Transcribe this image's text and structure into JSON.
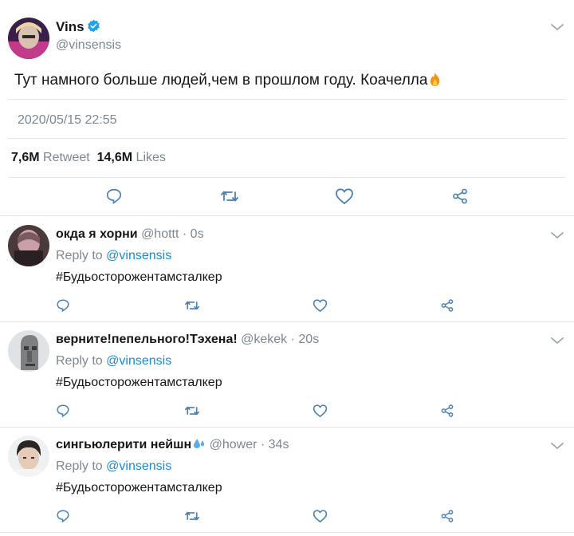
{
  "tweet": {
    "author_name": "Vins",
    "author_handle": "@vinsensis",
    "text": "Тут намного больше людей,чем в прошлом году. Коачелла",
    "text_emoji": "fire-emoji",
    "timestamp": "2020/05/15 22:55",
    "retweets_count": "7,6M",
    "retweets_label": "Retweet",
    "likes_count": "14,6M",
    "likes_label": "Likes"
  },
  "replies": [
    {
      "name": "окда я хорни",
      "handle": "@hottt",
      "time": "0s",
      "reply_prefix": "Reply to",
      "reply_handle": "@vinsensis",
      "text": "#Будьосторожентамсталкер"
    },
    {
      "name": "верните!пепельного!Тэхена!",
      "handle": "@kekek",
      "time": "20s",
      "reply_prefix": "Reply to",
      "reply_handle": "@vinsensis",
      "text": "#Будьосторожентамсталкер"
    },
    {
      "name": "сингьюлерити нейшн",
      "name_emoji": "sweat-droplets-emoji",
      "handle": "@hower",
      "time": "34s",
      "reply_prefix": "Reply to",
      "reply_handle": "@vinsensis",
      "text": "#Будьосторожентамсталкер"
    }
  ],
  "separator_dot": "·",
  "colors": {
    "link": "#1a8ad0",
    "muted": "#7c8791",
    "verified": "#1da1f2",
    "icon": "#4a7fb0"
  }
}
